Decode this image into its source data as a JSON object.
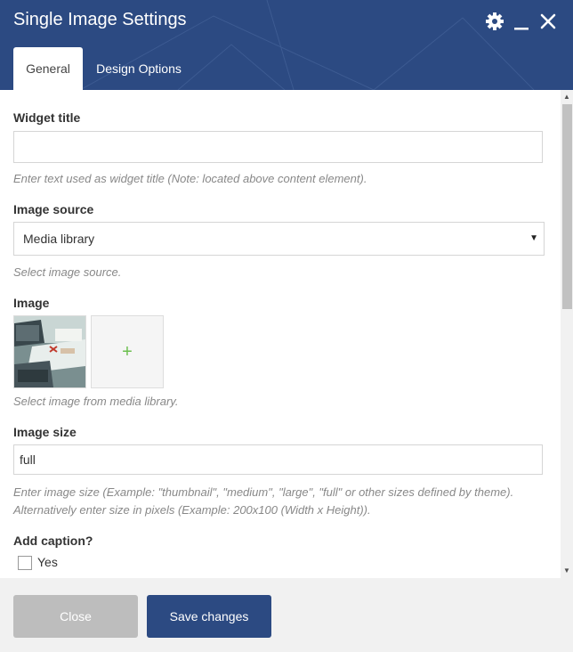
{
  "window": {
    "title": "Single Image Settings",
    "icons": [
      "gear-icon",
      "minimize-icon",
      "close-icon"
    ]
  },
  "tabs": [
    {
      "label": "General",
      "active": true
    },
    {
      "label": "Design Options",
      "active": false
    }
  ],
  "form": {
    "widget_title": {
      "label": "Widget title",
      "value": "",
      "hint": "Enter text used as widget title (Note: located above content element)."
    },
    "image_source": {
      "label": "Image source",
      "selected": "Media library",
      "hint": "Select image source."
    },
    "image": {
      "label": "Image",
      "add_symbol": "+",
      "hint": "Select image from media library."
    },
    "image_size": {
      "label": "Image size",
      "value": "full",
      "hint": "Enter image size (Example: \"thumbnail\", \"medium\", \"large\", \"full\" or other sizes defined by theme). Alternatively enter size in pixels (Example: 200x100 (Width x Height))."
    },
    "add_caption": {
      "label": "Add caption?",
      "option_label": "Yes",
      "checked": false
    }
  },
  "footer": {
    "close_label": "Close",
    "save_label": "Save changes"
  },
  "colors": {
    "header_bg": "#2c4a82",
    "primary_button": "#2c4a82",
    "disabled_button": "#bdbdbd",
    "add_plus": "#6bbf4e"
  }
}
